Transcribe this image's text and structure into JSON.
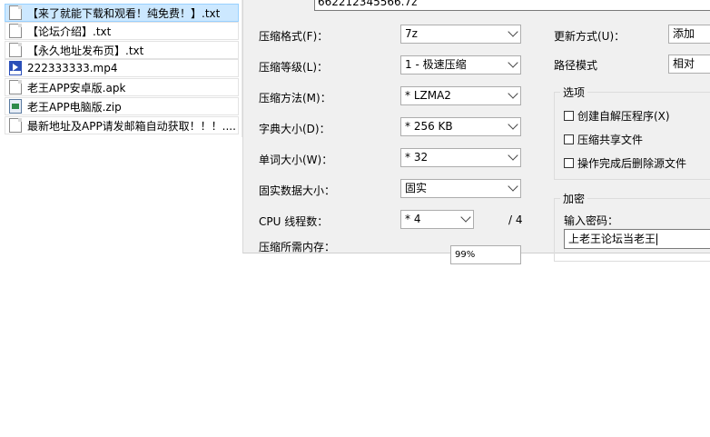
{
  "files": [
    {
      "name": "【来了就能下载和观看！纯免费！】.txt",
      "icon": "text-file-icon",
      "selected": true
    },
    {
      "name": "【论坛介绍】.txt",
      "icon": "text-file-icon",
      "selected": false
    },
    {
      "name": "【永久地址发布页】.txt",
      "icon": "text-file-icon",
      "selected": false
    },
    {
      "name": "222333333.mp4",
      "icon": "mp4-video-icon",
      "selected": false
    },
    {
      "name": "老王APP安卓版.apk",
      "icon": "text-file-icon",
      "selected": false
    },
    {
      "name": "老王APP电脑版.zip",
      "icon": "zip-archive-icon",
      "selected": false
    },
    {
      "name": "最新地址及APP请发邮箱自动获取！！！....",
      "icon": "text-file-icon",
      "selected": false
    }
  ],
  "dialog": {
    "archive_name": "662212345566.7z",
    "format": {
      "label": "压缩格式(F)：",
      "value": "7z"
    },
    "level": {
      "label": "压缩等级(L)：",
      "value": "1 - 极速压缩"
    },
    "method": {
      "label": "压缩方法(M)：",
      "value": "* LZMA2"
    },
    "dict_size": {
      "label": "字典大小(D)：",
      "value": "* 256 KB"
    },
    "word_size": {
      "label": "单词大小(W)：",
      "value": "* 32"
    },
    "solid_size": {
      "label": "固实数据大小：",
      "value": "固实"
    },
    "threads": {
      "label": "CPU 线程数：",
      "value": "* 4",
      "max": "/ 4"
    },
    "memory": {
      "label": "压缩所需内存：",
      "value": "99%"
    },
    "update_mode": {
      "label": "更新方式(U)：",
      "value": "添加"
    },
    "path_mode": {
      "label": "路径模式",
      "value": "相对"
    },
    "options": {
      "title": "选项",
      "sfx": "创建自解压程序(X)",
      "shared": "压缩共享文件",
      "delete_after": "操作完成后删除源文件"
    },
    "encryption": {
      "title": "加密",
      "password_label": "输入密码：",
      "password_value": "上老王论坛当老王"
    }
  }
}
